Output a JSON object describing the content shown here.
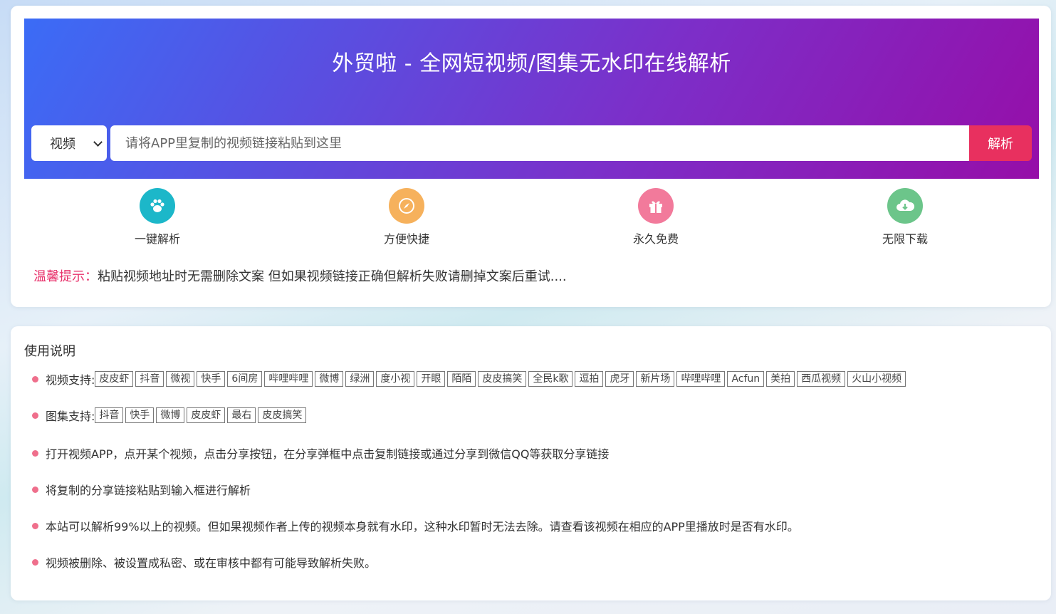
{
  "header": {
    "title": "外贸啦 - 全网短视频/图集无水印在线解析"
  },
  "search": {
    "type_select": "视频",
    "placeholder": "请将APP里复制的视频链接粘贴到这里",
    "parse_label": "解析"
  },
  "features": [
    {
      "label": "一键解析",
      "icon": "paw-icon",
      "color": "#1cb7c9"
    },
    {
      "label": "方便快捷",
      "icon": "compass-icon",
      "color": "#f6b15c"
    },
    {
      "label": "永久免费",
      "icon": "gift-icon",
      "color": "#f27a9b"
    },
    {
      "label": "无限下载",
      "icon": "cloud-download-icon",
      "color": "#6cc58a"
    }
  ],
  "tip": {
    "label": "温馨提示：",
    "text": "粘贴视频地址时无需删除文案 但如果视频链接正确但解析失败请删掉文案后重试...."
  },
  "usage": {
    "title": "使用说明",
    "video_support_label": "视频支持:",
    "video_platforms": [
      "皮皮虾",
      "抖音",
      "微视",
      "快手",
      "6间房",
      "哔哩哔哩",
      "微博",
      "绿洲",
      "度小视",
      "开眼",
      "陌陌",
      "皮皮搞笑",
      "全民k歌",
      "逗拍",
      "虎牙",
      "新片场",
      "哔哩哔哩",
      "Acfun",
      "美拍",
      "西瓜视频",
      "火山小视频"
    ],
    "album_support_label": "图集支持:",
    "album_platforms": [
      "抖音",
      "快手",
      "微博",
      "皮皮虾",
      "最右",
      "皮皮搞笑"
    ],
    "notes": [
      "打开视频APP，点开某个视频，点击分享按钮，在分享弹框中点击复制链接或通过分享到微信QQ等获取分享链接",
      "将复制的分享链接粘贴到输入框进行解析",
      "本站可以解析99%以上的视频。但如果视频作者上传的视频本身就有水印，这种水印暂时无法去除。请查看该视频在相应的APP里播放时是否有水印。",
      "视频被删除、被设置成私密、或在审核中都有可能导致解析失败。"
    ]
  },
  "colors": {
    "accent": "#e8305f",
    "tip": "#e8336c",
    "bullet": "#ef6f8c"
  }
}
